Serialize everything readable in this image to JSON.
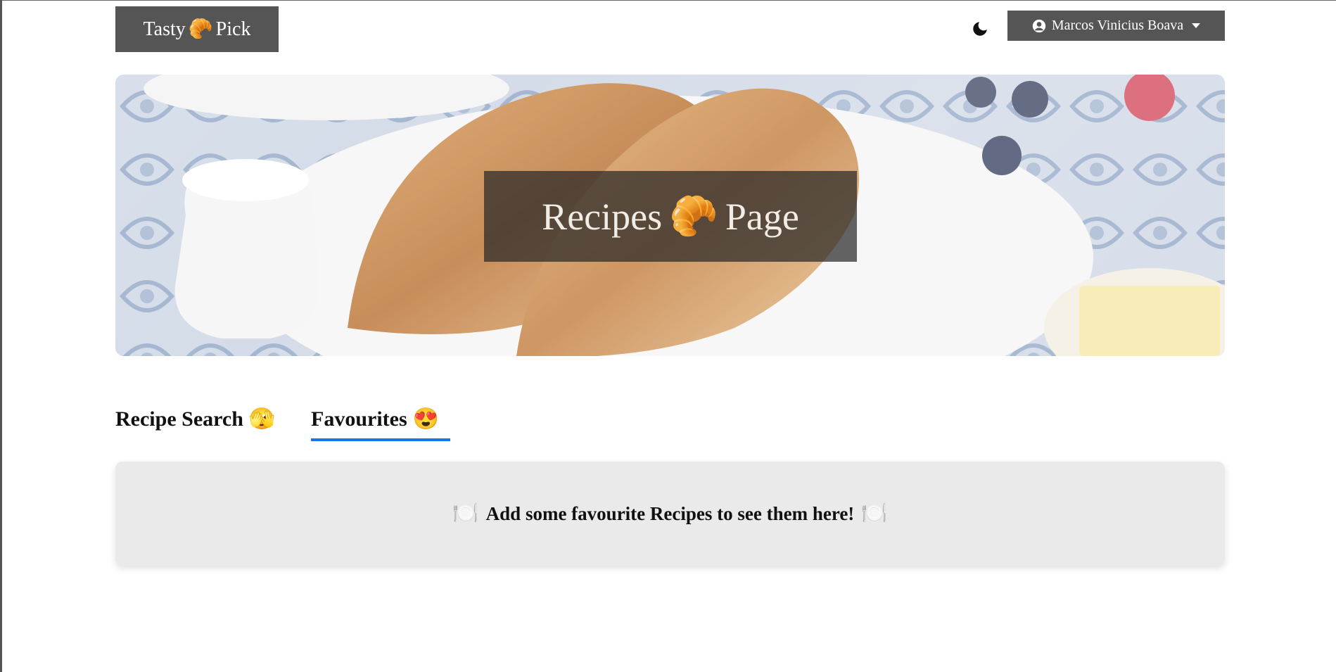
{
  "header": {
    "brand_left": "Tasty",
    "brand_right": "Pick",
    "brand_icon": "🥐",
    "theme_toggle_icon": "moon-icon",
    "user_name": "Marcos Vinicius Boava",
    "user_icon": "user-circle-icon"
  },
  "hero": {
    "title_left": "Recipes",
    "title_icon": "🥐",
    "title_right": "Page"
  },
  "tabs": [
    {
      "label": "Recipe Search",
      "emoji": "🫣",
      "active": false
    },
    {
      "label": "Favourites",
      "emoji": "😍",
      "active": true
    }
  ],
  "favourites": {
    "empty_message": "Add some favourite Recipes to see them here!",
    "empty_icon": "🍽️"
  },
  "colors": {
    "header_button_bg": "#555555",
    "active_tab_underline": "#1a73e8",
    "empty_card_bg": "#eaeaea"
  }
}
